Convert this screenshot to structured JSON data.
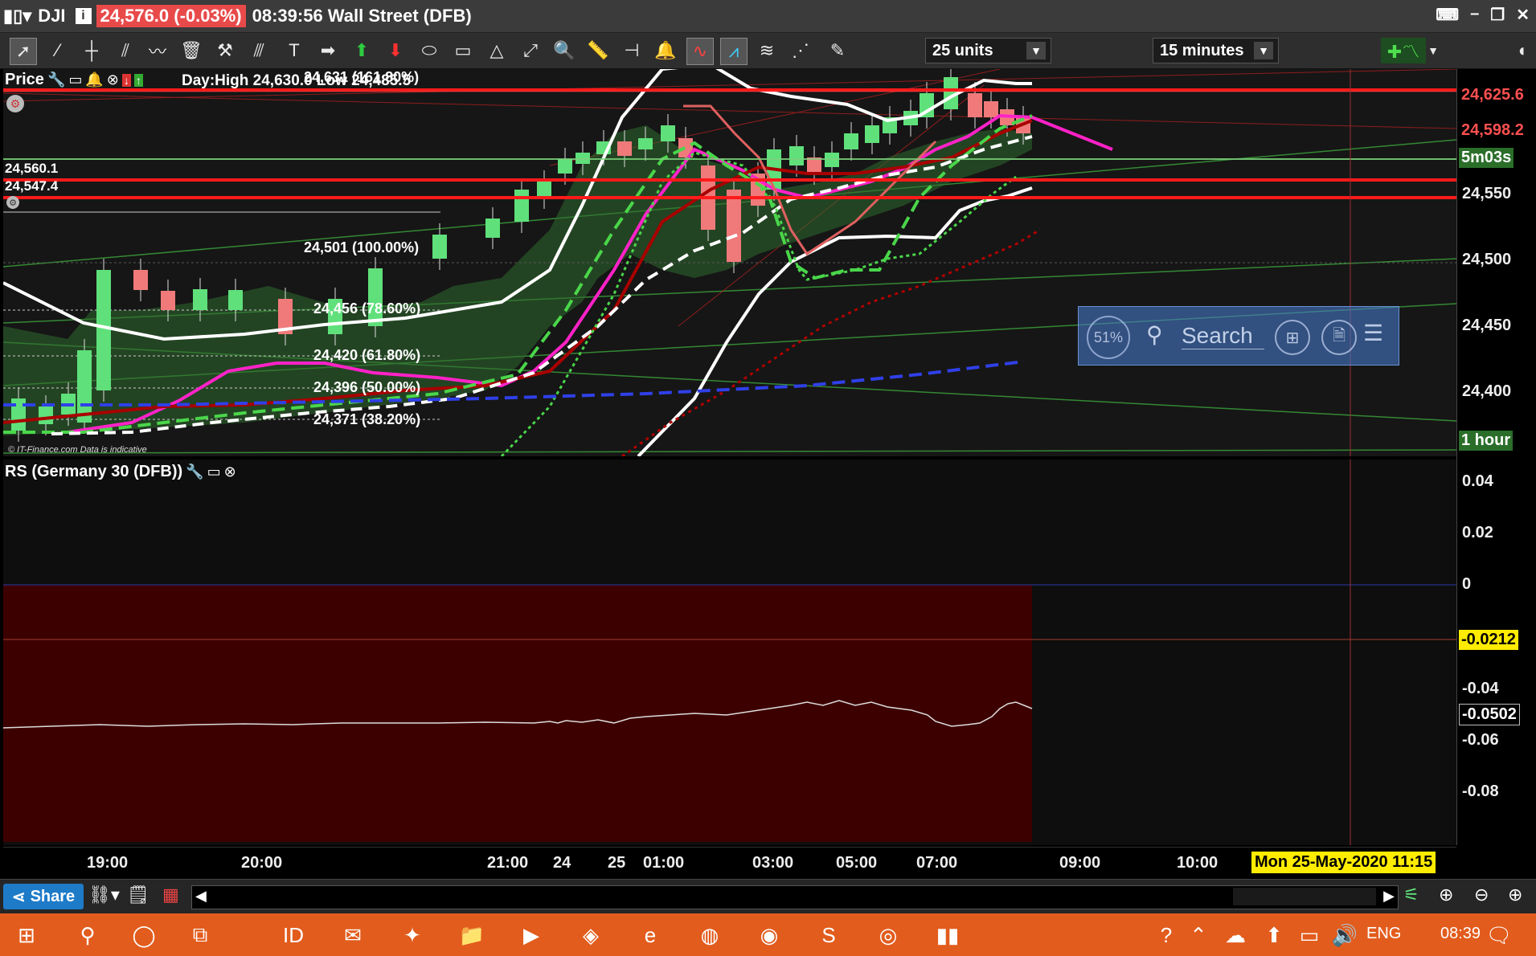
{
  "window": {
    "symbol": "DJI",
    "price_change": "24,576.0 (-0.03%)",
    "time_market": "08:39:56 Wall Street (DFB)"
  },
  "toolbar": {
    "units_value": "25 units",
    "interval_value": "15 minutes"
  },
  "price_pane": {
    "title": "Price",
    "day_high_low": "Day:High 24,630.0 Low 24,485.5",
    "left_labels": [
      "24,560.1",
      "24,547.4"
    ],
    "fib_levels": [
      "24,631 (161.80%)",
      "24,501 (100.00%)",
      "24,456 (78.60%)",
      "24,420 (61.80%)",
      "24,396 (50.00%)",
      "24,371 (38.20%)"
    ],
    "watermark": "© IT-Finance.com  Data is indicative"
  },
  "search_overlay": {
    "badge": "51%",
    "placeholder": "Search"
  },
  "rs_pane": {
    "title": "RS (Germany 30 (DFB))"
  },
  "price_axis": {
    "ticks": [
      "24,550",
      "24,500",
      "24,450",
      "24,400"
    ],
    "badges": {
      "high": "24,625.6",
      "mid": "24,598.2",
      "timer": "5m03s",
      "period": "1 hour"
    }
  },
  "rs_axis": {
    "ticks": [
      "0.04",
      "0.02",
      "0",
      "-0.04",
      "-0.06",
      "-0.08"
    ],
    "badges": {
      "current": "-0.0212",
      "value": "-0.0502"
    }
  },
  "time_axis": {
    "ticks": [
      "19:00",
      "20:00",
      "21:00",
      "24",
      "25",
      "01:00",
      "03:00",
      "05:00",
      "07:00",
      "09:00",
      "10:00"
    ],
    "cursor_date": "Mon 25-May-2020 11:15"
  },
  "bottom": {
    "share_label": "Share"
  },
  "taskbar": {
    "language": "ENG",
    "clock": "08:39"
  },
  "colors": {
    "bullish": "#5fe07a",
    "bearish": "#f07a7a",
    "support_line": "#ff1a1a",
    "accent_badge": "#ffec00"
  }
}
